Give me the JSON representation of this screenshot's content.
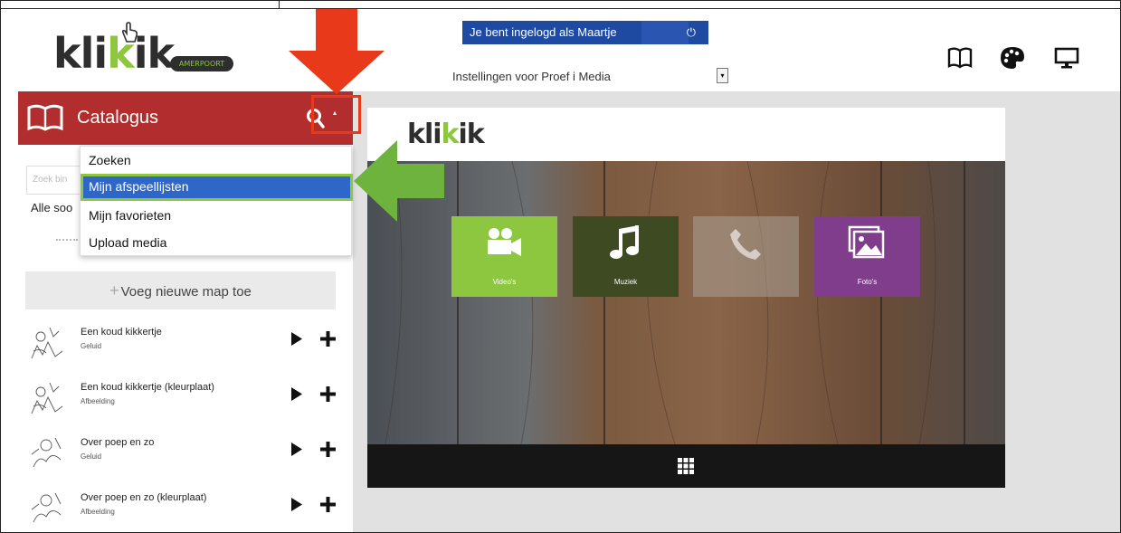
{
  "header": {
    "logo_text_dark": "kli",
    "logo_text_green": "k",
    "logo_text_dark2": "ik",
    "logo_badge": "AMERPOORT",
    "login_text": "Je bent ingelogd als Maartje",
    "settings_label": "Instellingen voor  Proef i Media",
    "icons": [
      "book-icon",
      "palette-icon",
      "monitor-icon"
    ]
  },
  "sidebar": {
    "title": "Catalogus",
    "search_placeholder": "Zoek bin",
    "filter_label": "Alle soo",
    "add_folder_label": "Voeg nieuwe map toe",
    "items": [
      {
        "title": "Een koud kikkertje",
        "type": "Geluid"
      },
      {
        "title": "Een koud kikkertje (kleurplaat)",
        "type": "Afbeelding"
      },
      {
        "title": "Over poep en zo",
        "type": "Geluid"
      },
      {
        "title": "Over poep en zo (kleurplaat)",
        "type": "Afbeelding"
      }
    ]
  },
  "dropdown": {
    "items": [
      {
        "label": "Zoeken",
        "active": false
      },
      {
        "label": "Mijn afspeellijsten",
        "active": true
      },
      {
        "label": "Mijn favorieten",
        "active": false
      },
      {
        "label": "Upload media",
        "active": false
      }
    ]
  },
  "panel": {
    "logo_dark": "kli",
    "logo_green": "k",
    "logo_dark2": "ik",
    "tiles": [
      {
        "label": "Video's",
        "color": "#8dc63f",
        "icon": "video-camera-icon"
      },
      {
        "label": "Muziek",
        "color": "#3d4a22",
        "icon": "music-note-icon"
      },
      {
        "label": "",
        "color": "#9a8c80",
        "icon": "phone-icon"
      },
      {
        "label": "Foto's",
        "color": "#7f3d8c",
        "icon": "photos-icon"
      }
    ]
  },
  "colors": {
    "brand_green": "#8dc63f",
    "catalog_red": "#b22e2e",
    "login_blue": "#1f4aa1",
    "highlight_blue": "#2f67c9",
    "annotation_red": "#e83a1a",
    "annotation_green": "#6fb33f"
  }
}
